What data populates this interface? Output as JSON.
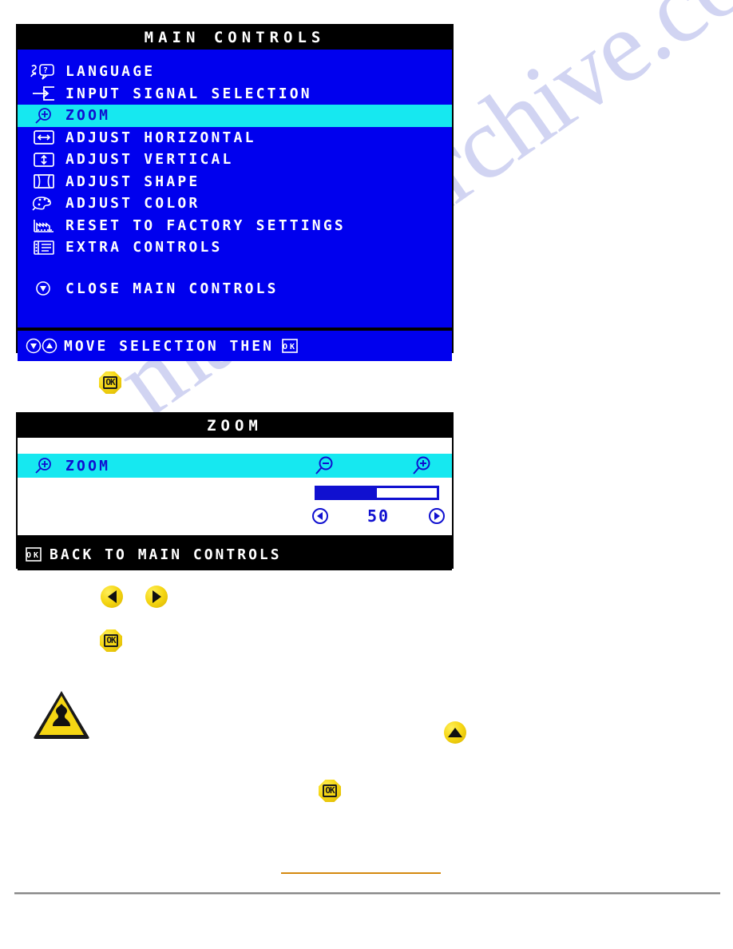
{
  "watermark": {
    "text": "manualsarchive.com",
    "color": "#c9cdf0"
  },
  "colors": {
    "osd_blue": "#0000ee",
    "osd_highlight_cyan": "#16e8f0",
    "osd_text_white": "#ffffff",
    "osd_text_blue": "#1010d0",
    "key_yellow": "#f5d613",
    "link_orange": "#d4890f",
    "divider_gray": "#888888"
  },
  "main_controls": {
    "title": "MAIN CONTROLS",
    "items": [
      {
        "icon": "language-person-question-icon",
        "label": "LANGUAGE",
        "selected": false
      },
      {
        "icon": "input-signal-arrow-into-box-icon",
        "label": "INPUT SIGNAL SELECTION",
        "selected": false
      },
      {
        "icon": "zoom-magnifier-plus-icon",
        "label": "ZOOM",
        "selected": true
      },
      {
        "icon": "adjust-horizontal-arrows-icon",
        "label": "ADJUST HORIZONTAL",
        "selected": false
      },
      {
        "icon": "adjust-vertical-arrows-icon",
        "label": "ADJUST VERTICAL",
        "selected": false
      },
      {
        "icon": "adjust-shape-pincushion-icon",
        "label": "ADJUST SHAPE",
        "selected": false
      },
      {
        "icon": "adjust-color-palette-icon",
        "label": "ADJUST COLOR",
        "selected": false
      },
      {
        "icon": "reset-factory-building-icon",
        "label": "RESET TO FACTORY SETTINGS",
        "selected": false
      },
      {
        "icon": "extra-controls-list-icon",
        "label": "EXTRA CONTROLS",
        "selected": false
      }
    ],
    "close_item": {
      "icon": "close-down-arrow-circle-icon",
      "label": "CLOSE MAIN CONTROLS"
    },
    "footer": {
      "icons": [
        "down-arrow-circle-icon",
        "up-arrow-circle-icon"
      ],
      "label": "MOVE SELECTION THEN",
      "trailing_icon": "ok-key-icon"
    }
  },
  "zoom_panel": {
    "title": "ZOOM",
    "row": {
      "icon": "zoom-magnifier-plus-icon",
      "label": "ZOOM",
      "decrease_icon": "magnifier-minus-icon",
      "increase_icon": "magnifier-plus-icon"
    },
    "slider": {
      "value": 50,
      "min": 0,
      "max": 100,
      "fill_percent": 50
    },
    "left_arrow_icon": "left-arrow-circle-icon",
    "right_arrow_icon": "right-arrow-circle-icon",
    "value_label": "50",
    "footer": {
      "icon": "ok-key-icon",
      "label": "BACK TO MAIN CONTROLS"
    }
  },
  "keys": {
    "ok_label": "OK",
    "ok_key_1": "ok-key-button",
    "left_key": "left-arrow-key-button",
    "right_key": "right-arrow-key-button",
    "ok_key_2": "ok-key-button",
    "up_key": "up-arrow-key-button",
    "ok_key_3": "ok-key-button"
  },
  "warning": {
    "icon": "warning-triangle-icon"
  }
}
